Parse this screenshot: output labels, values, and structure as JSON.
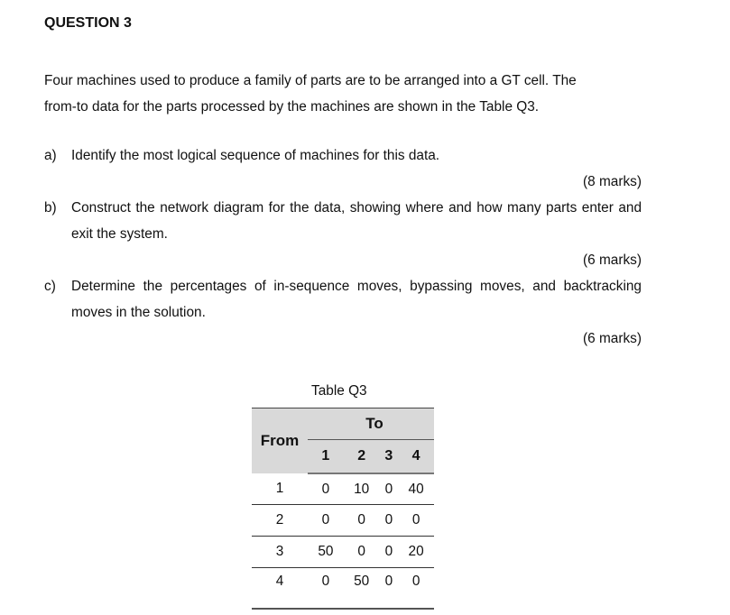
{
  "question": {
    "heading": "QUESTION 3",
    "intro_lines": [
      "Four machines used to produce a family of parts are to be arranged into a GT cell. The",
      "from-to data for the parts processed by the machines are shown in the Table Q3."
    ],
    "parts": [
      {
        "label": "a)",
        "text": "Identify the most logical sequence of machines for this data.",
        "marks": "(8 marks)"
      },
      {
        "label": "b)",
        "text": "Construct the network diagram for the data, showing where and how many parts enter and exit the system.",
        "marks": "(6 marks)"
      },
      {
        "label": "c)",
        "text": "Determine the percentages of in-sequence moves, bypassing moves, and backtracking moves in the solution.",
        "marks": "(6 marks)"
      }
    ]
  },
  "table": {
    "caption": "Table Q3",
    "row_header_label": "From",
    "col_group_label": "To",
    "columns": [
      "1",
      "2",
      "3",
      "4"
    ],
    "rows": [
      {
        "from": "1",
        "values": [
          "0",
          "10",
          "0",
          "40"
        ]
      },
      {
        "from": "2",
        "values": [
          "0",
          "0",
          "0",
          "0"
        ]
      },
      {
        "from": "3",
        "values": [
          "50",
          "0",
          "0",
          "20"
        ]
      },
      {
        "from": "4",
        "values": [
          "0",
          "50",
          "0",
          "0"
        ]
      }
    ]
  }
}
